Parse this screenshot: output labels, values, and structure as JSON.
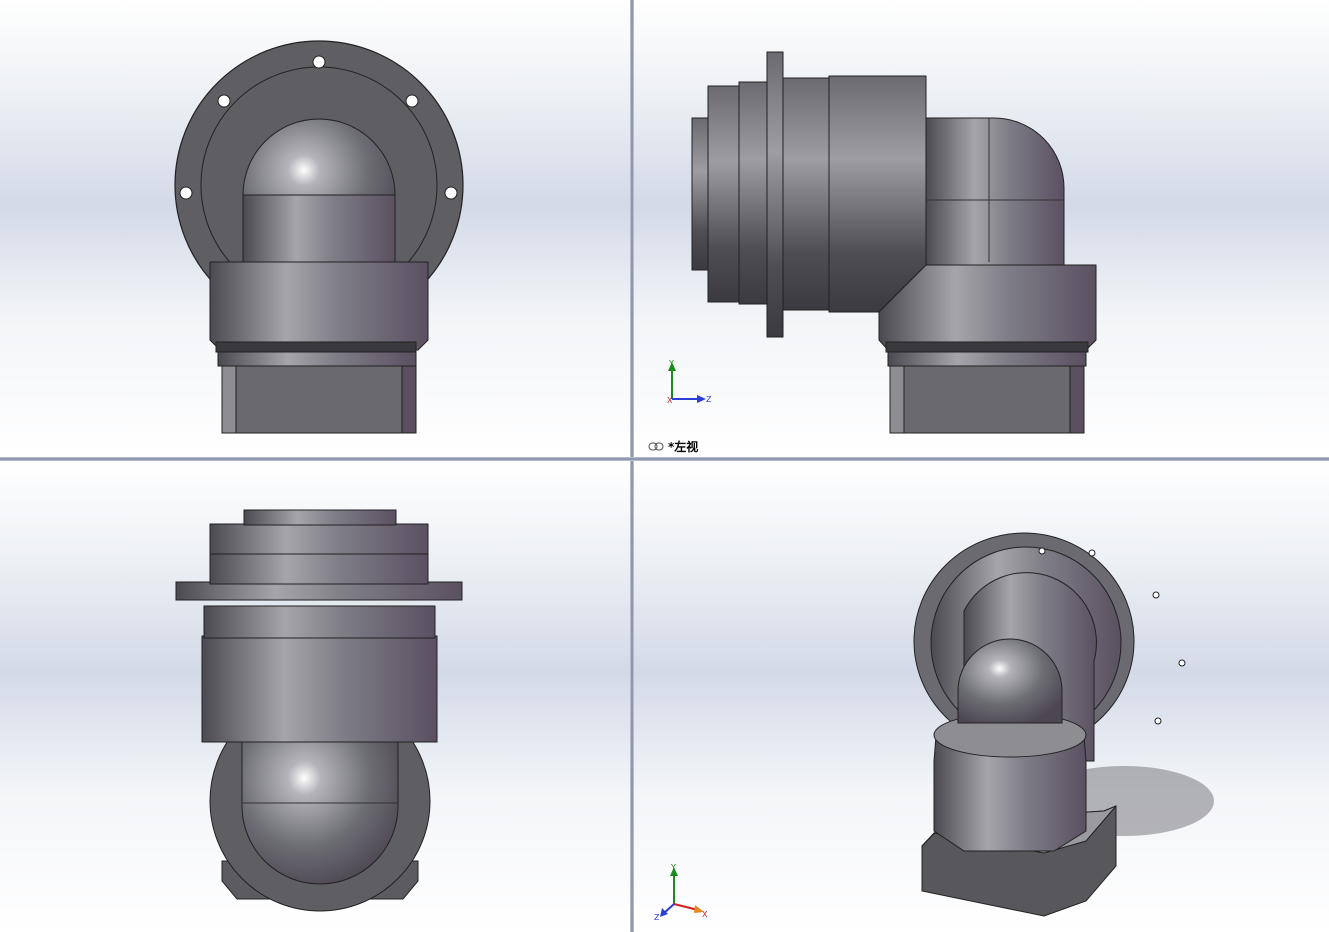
{
  "viewports": {
    "top_left": {
      "name": "front"
    },
    "top_right": {
      "name": "left",
      "label": "*左视"
    },
    "bottom_left": {
      "name": "top"
    },
    "bottom_right": {
      "name": "isometric"
    }
  },
  "triad": {
    "x_label": "X",
    "y_label": "Y",
    "z_label": "Z"
  },
  "colors": {
    "x_axis": "#d42020",
    "y_axis": "#1f8a1f",
    "z_axis": "#2b3fd6",
    "part": "#6e6e74"
  }
}
